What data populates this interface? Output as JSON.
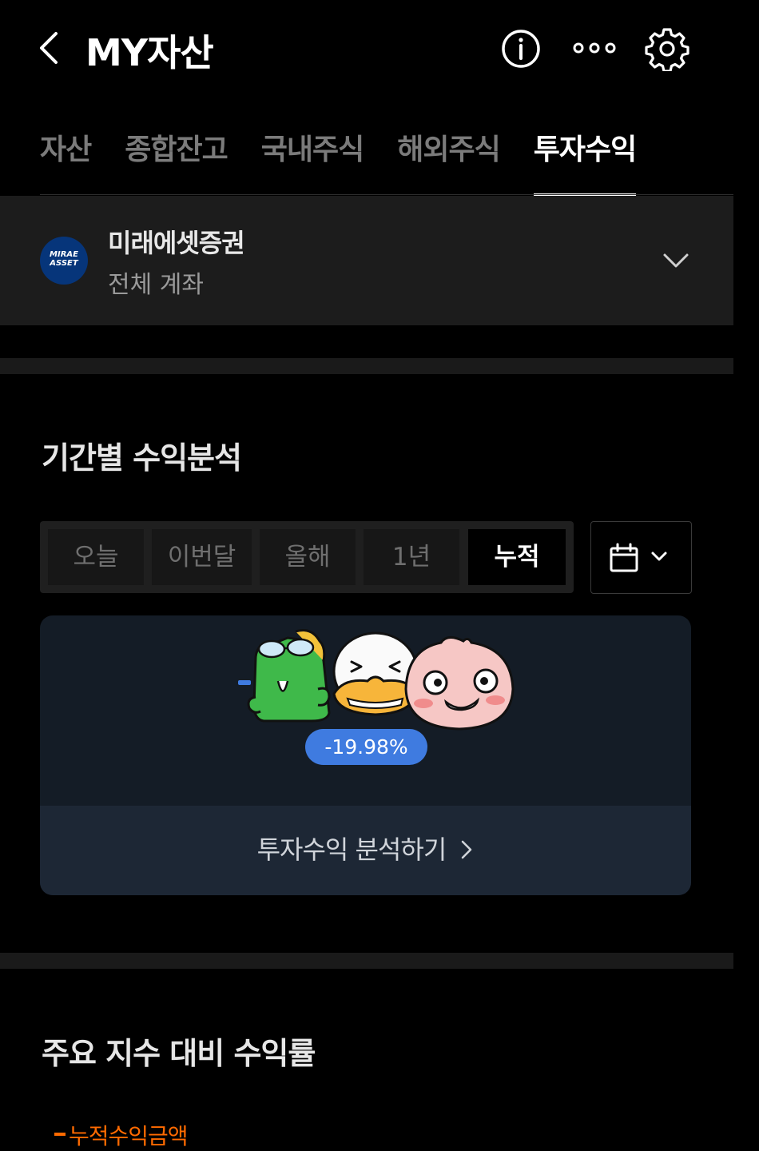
{
  "header": {
    "title": "MY자산"
  },
  "tabs": [
    {
      "label": "자산"
    },
    {
      "label": "종합잔고"
    },
    {
      "label": "국내주식"
    },
    {
      "label": "해외주식"
    },
    {
      "label": "투자수익"
    }
  ],
  "active_tab": "투자수익",
  "account": {
    "logo_text": "MIRAE ASSET",
    "name": "미래에셋증권",
    "subtitle": "전체 계좌"
  },
  "period_analysis": {
    "title": "기간별 수익분석",
    "periods": [
      {
        "label": "오늘"
      },
      {
        "label": "이번달"
      },
      {
        "label": "올해"
      },
      {
        "label": "1년"
      },
      {
        "label": "누적"
      }
    ],
    "selected_period": "누적",
    "return_badge": "-19.98%",
    "analyze_link": "투자수익 분석하기"
  },
  "index_compare": {
    "title": "주요 지수 대비 수익률",
    "legend_label": "누적수익금액"
  },
  "colors": {
    "background": "#000000",
    "panel": "#1c1c1c",
    "badge": "#3f7be0",
    "legend": "#ff6a00",
    "card": "#141c26"
  }
}
